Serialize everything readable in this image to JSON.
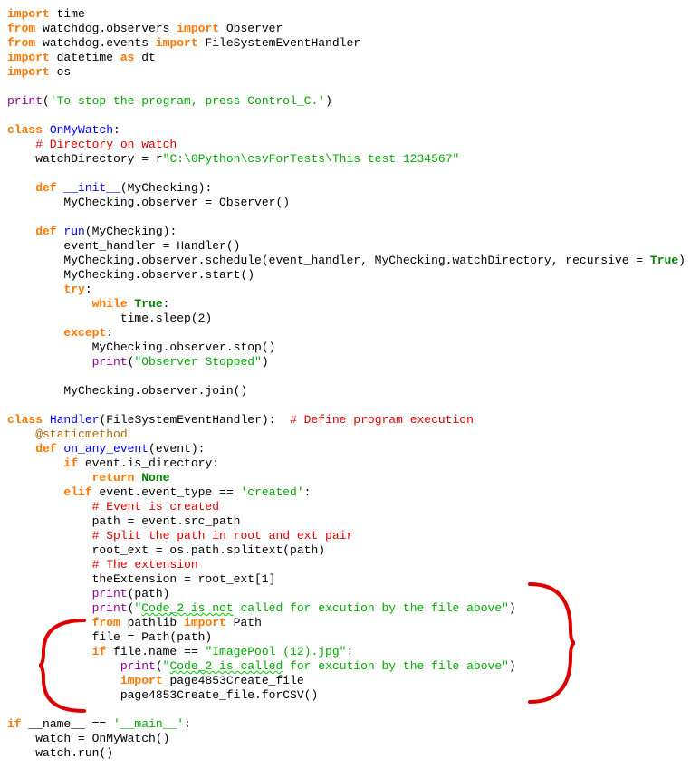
{
  "code": {
    "l1_import": "import",
    "l1_time": " time",
    "l2_from": "from",
    "l2_pkg": " watchdog.observers ",
    "l2_import": "import",
    "l2_obs": " Observer",
    "l3_from": "from",
    "l3_pkg": " watchdog.events ",
    "l3_import": "import",
    "l3_handler": " FileSystemEventHandler",
    "l4_import": "import",
    "l4_dt": " datetime ",
    "l4_as": "as",
    "l4_alias": " dt",
    "l5_import": "import",
    "l5_os": " os",
    "l7_print": "print",
    "l7_paren_open": "(",
    "l7_str": "'To stop the program, press Control_C.'",
    "l7_paren_close": ")",
    "l9_class": "class",
    "l9_name": " OnMyWatch",
    "l9_colon": ":",
    "l10_comment": "    # Directory on watch",
    "l11_code": "    watchDirectory = r",
    "l11_str": "\"C:\\0Python\\csvForTests\\This test 1234567\"",
    "l13_def": "    def",
    "l13_name": " __init__",
    "l13_params": "(MyChecking):",
    "l14_code": "        MyChecking.observer = Observer()",
    "l16_def": "    def",
    "l16_name": " run",
    "l16_params": "(MyChecking):",
    "l17_code": "        event_handler = Handler()",
    "l18_code": "        MyChecking.observer.schedule(event_handler, MyChecking.watchDirectory, recursive = ",
    "l18_true": "True",
    "l18_close": ")",
    "l19_code": "        MyChecking.observer.start()",
    "l20_try": "        try",
    "l20_colon": ":",
    "l21_while": "            while",
    "l21_true": " True",
    "l21_colon": ":",
    "l22_code": "                time.sleep(2)",
    "l23_except": "        except",
    "l23_colon": ":",
    "l24_code": "            MyChecking.observer.stop()",
    "l25_print": "            print",
    "l25_open": "(",
    "l25_str": "\"Observer Stopped\"",
    "l25_close": ")",
    "l27_code": "        MyChecking.observer.join()",
    "l29_class": "class",
    "l29_name": " Handler",
    "l29_params": "(FileSystemEventHandler):  ",
    "l29_comment": "# Define program execution",
    "l30_decorator": "    @staticmethod",
    "l31_def": "    def",
    "l31_name": " on_any_event",
    "l31_params": "(event):",
    "l32_if": "        if",
    "l32_code": " event.is_directory:",
    "l33_return": "            return",
    "l33_none": " None",
    "l34_elif": "        elif",
    "l34_code": " event.event_type == ",
    "l34_str": "'created'",
    "l34_colon": ":",
    "l35_comment": "            # Event is created",
    "l36_code": "            path = event.src_path",
    "l37_comment": "            # Split the path in root and ext pair",
    "l38_code": "            root_ext = os.path.splitext(path)",
    "l39_comment": "            # The extension",
    "l40_code": "            theExtension = root_ext[1]",
    "l41_print": "            print",
    "l41_code": "(path)",
    "l42_print": "            print",
    "l42_open": "(",
    "l42_str1": "\"",
    "l42_str2": "Code_2 is not",
    "l42_str3": " called for excution by the file above\"",
    "l42_close": ")",
    "l43_from": "            from",
    "l43_pkg": " pathlib ",
    "l43_import": "import",
    "l43_path": " Path",
    "l44_code": "            file = Path(path)",
    "l45_if": "            if",
    "l45_code": " file.name == ",
    "l45_str": "\"ImagePool (12).jpg\"",
    "l45_colon": ":",
    "l46_print": "                print",
    "l46_open": "(",
    "l46_str1": "\"",
    "l46_str2": "Code_2 is called",
    "l46_str3": " for excution by the file above\"",
    "l46_close": ")",
    "l47_import": "                import",
    "l47_mod": " page4853Create_file",
    "l48_code": "                page4853Create_file.forCSV()",
    "l50_if": "if",
    "l50_name": " __name__ == ",
    "l50_str": "'__main__'",
    "l50_colon": ":",
    "l51_code": "    watch = OnMyWatch()",
    "l52_code": "    watch.run()"
  }
}
